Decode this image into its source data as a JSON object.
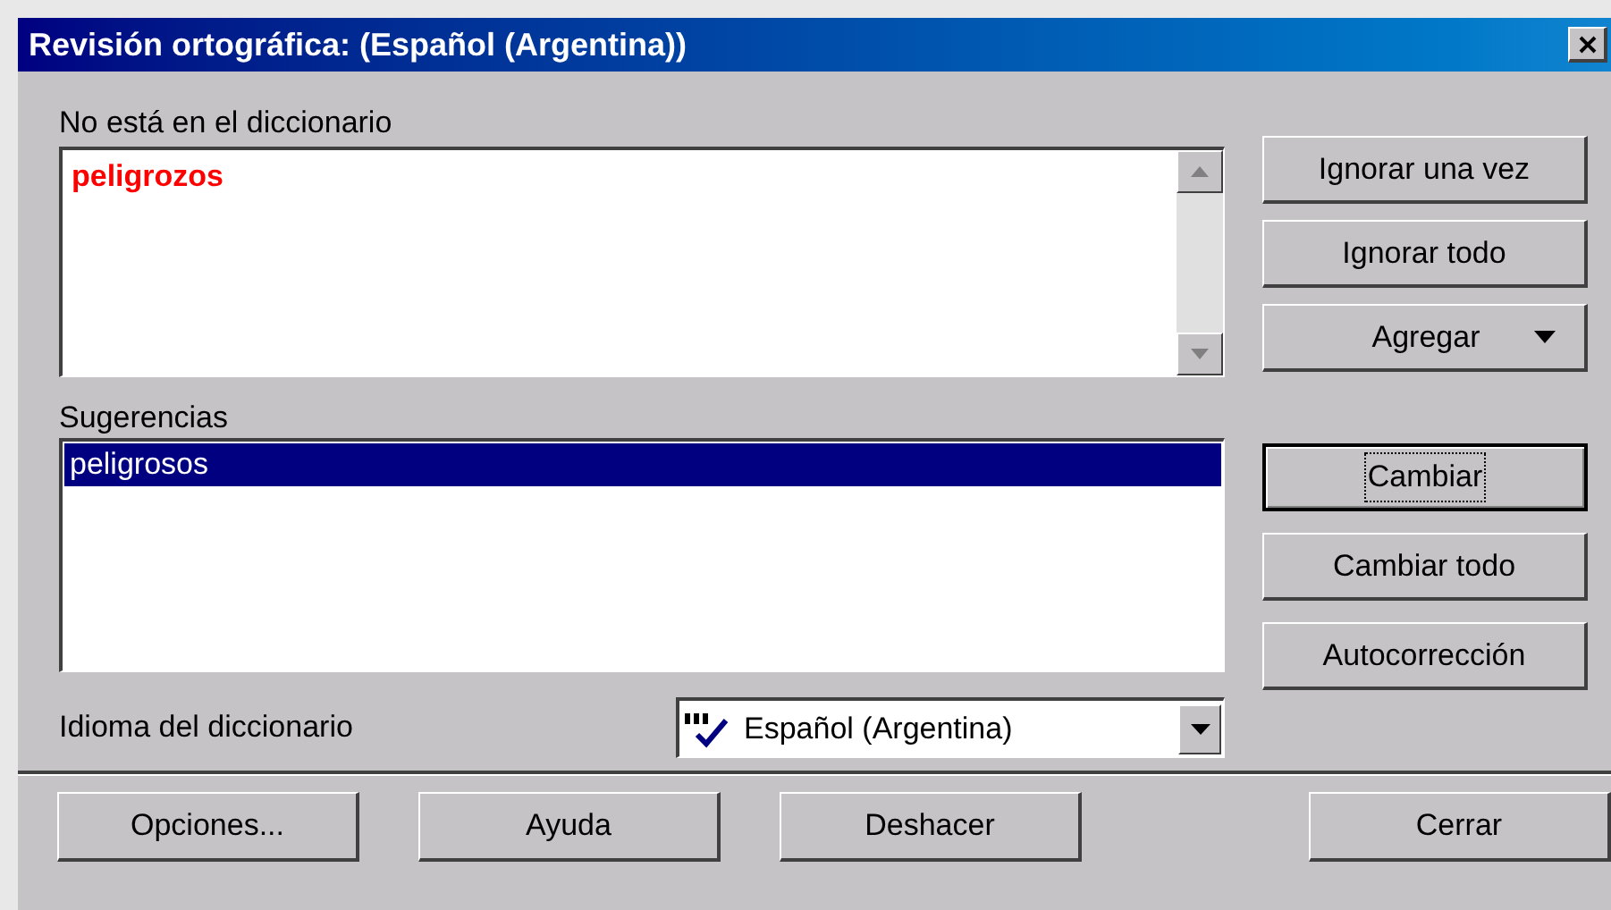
{
  "window": {
    "title": "Revisión ortográfica:  (Español (Argentina))"
  },
  "not_in_dictionary": {
    "label": "No está en el diccionario",
    "text": "peligrozos"
  },
  "suggestions": {
    "label": "Sugerencias",
    "items": [
      {
        "text": "peligrosos",
        "selected": true
      }
    ]
  },
  "dictionary_language": {
    "label": "Idioma del diccionario",
    "value": "Español (Argentina)"
  },
  "side_button_groups": [
    [
      {
        "label": "Ignorar una vez",
        "kind": "plain",
        "default": false
      },
      {
        "label": "Ignorar todo",
        "kind": "plain",
        "default": false
      },
      {
        "label": "Agregar",
        "kind": "dropdown",
        "default": false
      }
    ],
    [
      {
        "label": "Cambiar",
        "kind": "plain",
        "default": true
      },
      {
        "label": "Cambiar todo",
        "kind": "plain",
        "default": false
      },
      {
        "label": "Autocorrección",
        "kind": "plain",
        "default": false
      }
    ]
  ],
  "bottom_buttons": [
    {
      "label": "Opciones..."
    },
    {
      "label": "Ayuda"
    },
    {
      "label": "Deshacer"
    },
    {
      "label": "Cerrar"
    }
  ]
}
